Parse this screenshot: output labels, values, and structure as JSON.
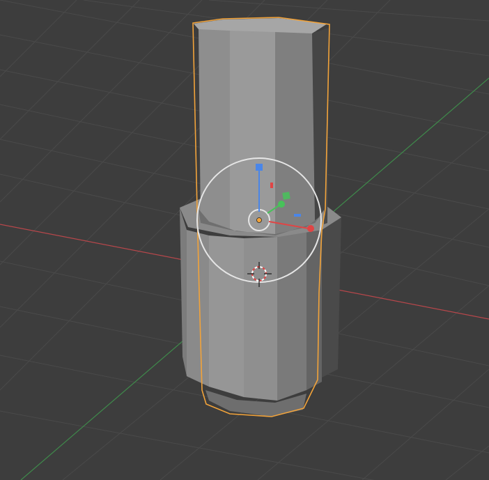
{
  "app": {
    "context": "3d-viewport"
  },
  "viewport": {
    "background": "#3d3d3d",
    "grid_color": "#4a4a4a",
    "axis_x_color": "#b8474b",
    "axis_y_color": "#3f8a4b"
  },
  "selection": {
    "outline_color": "#f2a33a"
  },
  "gizmo": {
    "ring_color": "#e6e6e6",
    "x_color": "#e04545",
    "y_color": "#48c25a",
    "z_color": "#4a86e8",
    "origin_color": "#f2a33a"
  },
  "cursor_3d": {
    "ring_color": "#e04545",
    "ring_alt_color": "#ffffff",
    "cross_color": "#1a1a1a"
  },
  "objects": [
    {
      "icon": "cylinder-object-icon",
      "selected": true
    },
    {
      "icon": "cylinder-object-icon",
      "selected": false
    }
  ]
}
